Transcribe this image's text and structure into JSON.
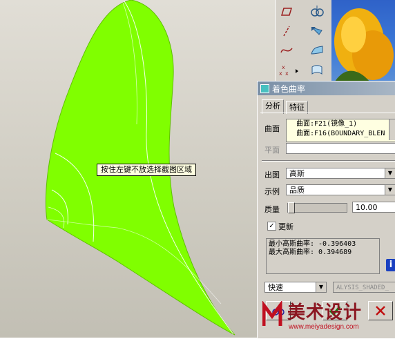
{
  "viewport": {
    "tooltip": "按住左键不放选择截图区域"
  },
  "dialog": {
    "title": "着色曲率",
    "tabs": [
      {
        "label": "分析"
      },
      {
        "label": "特征"
      }
    ],
    "surface_label": "曲面",
    "surface_items": [
      "曲面:F21(镜像_1)",
      "曲面:F16(BOUNDARY_BLEN"
    ],
    "plane_label": "平面",
    "plane_value": "",
    "output_label": "出图",
    "output_value": "高斯",
    "sample_label": "示例",
    "sample_value": "品质",
    "quality_label": "质量",
    "quality_value": "10.00",
    "quality_level": 0.0,
    "update_label": "更新",
    "update_checked": true,
    "result_min": "最小高斯曲率: -0.396403",
    "result_max": "最大高斯曲率:  0.394689",
    "speed_value": "快速",
    "analysis_name": "ALYSIS_SHADED_"
  },
  "watermark": {
    "logo_text": "美术设计",
    "url": "www.meiyadesign.com"
  },
  "colors": {
    "surface": "#80ff00",
    "dialog_bg": "#d4d0c8",
    "titlebar": "#8a9bb0"
  }
}
